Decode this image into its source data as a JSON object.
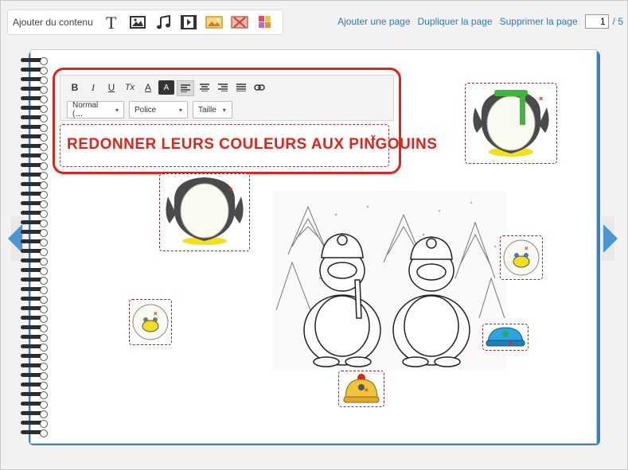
{
  "toolbar": {
    "add_content_label": "Ajouter du contenu",
    "tools": [
      "text-tool-icon",
      "image-tool-icon",
      "music-tool-icon",
      "video-tool-icon",
      "image-gallery-icon",
      "delete-image-icon",
      "color-palette-icon"
    ],
    "add_page": "Ajouter une page",
    "duplicate_page": "Dupliquer la page",
    "delete_page": "Supprimer la page",
    "current_page": "1",
    "total_pages": "/ 5"
  },
  "editor": {
    "format_buttons": [
      "B",
      "I",
      "U",
      "Tx",
      "A",
      "A",
      "align-left",
      "align-center",
      "align-right",
      "justify",
      "link"
    ],
    "style_select": "Normal (…",
    "font_select": "Police",
    "size_select": "Taille",
    "content": "REDONNER LEURS COULEURS AUX PINGOUINS",
    "close": "x"
  },
  "colors": {
    "accent_blue": "#2a7ab9",
    "title_red": "#e2231a",
    "notebook_blue": "#3a7fc0",
    "scarf_green": "#3db83d",
    "hat_yellow": "#f0c43a",
    "hat_blue": "#2aa7e0"
  }
}
